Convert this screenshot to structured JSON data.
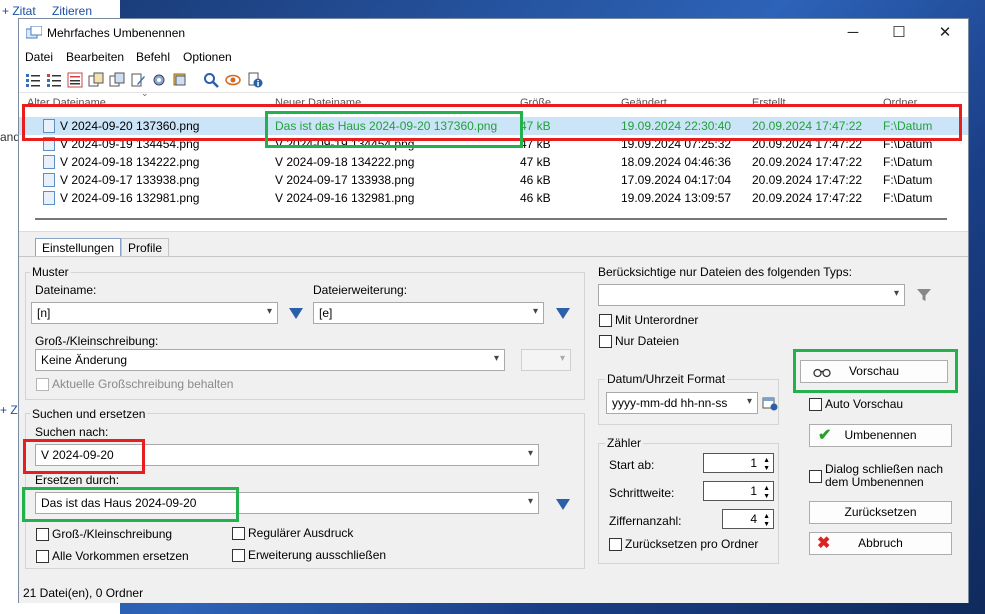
{
  "background": {
    "zitat": "+ Zitat",
    "zitieren": "Zitieren",
    "side_and": "and",
    "side_plus": "+ Z"
  },
  "window": {
    "title": "Mehrfaches Umbenennen",
    "minimize": "─",
    "maximize": "☐",
    "close": "✕"
  },
  "menu": {
    "items": [
      "Datei",
      "Bearbeiten",
      "Befehl",
      "Optionen"
    ]
  },
  "columns": [
    "Alter Dateiname",
    "Neuer Dateiname",
    "Größe",
    "Geändert",
    "Erstellt",
    "Ordner"
  ],
  "rows": [
    {
      "old": "V 2024-09-20 137360.png",
      "new": "Das ist das Haus 2024-09-20 137360.png",
      "size": "47 kB",
      "modified": "19.09.2024 22:30:40",
      "created": "20.09.2024 17:47:22",
      "folder": "F:\\Datum"
    },
    {
      "old": "V 2024-09-19 134454.png",
      "new": "V 2024-09-19 134454.png",
      "size": "47 kB",
      "modified": "19.09.2024 07:25:32",
      "created": "20.09.2024 17:47:22",
      "folder": "F:\\Datum"
    },
    {
      "old": "V 2024-09-18 134222.png",
      "new": "V 2024-09-18 134222.png",
      "size": "47 kB",
      "modified": "18.09.2024 04:46:36",
      "created": "20.09.2024 17:47:22",
      "folder": "F:\\Datum"
    },
    {
      "old": "V 2024-09-17 133938.png",
      "new": "V 2024-09-17 133938.png",
      "size": "46 kB",
      "modified": "17.09.2024 04:17:04",
      "created": "20.09.2024 17:47:22",
      "folder": "F:\\Datum"
    },
    {
      "old": "V 2024-09-16 132981.png",
      "new": "V 2024-09-16 132981.png",
      "size": "46 kB",
      "modified": "19.09.2024 13:09:57",
      "created": "20.09.2024 17:47:22",
      "folder": "F:\\Datum"
    }
  ],
  "tabs": [
    "Einstellungen",
    "Profile"
  ],
  "muster": {
    "group": "Muster",
    "filename_label": "Dateiname:",
    "filename_value": "[n]",
    "ext_label": "Dateierweiterung:",
    "ext_value": "[e]",
    "case_label": "Groß-/Kleinschreibung:",
    "case_value": "Keine Änderung",
    "keep_case": "Aktuelle Großschreibung behalten"
  },
  "search": {
    "group": "Suchen und ersetzen",
    "find_label": "Suchen nach:",
    "find_value": "V 2024-09-20",
    "replace_label": "Ersetzen durch:",
    "replace_value": "Das ist das Haus 2024-09-20",
    "case_sensitive": "Groß-/Kleinschreibung",
    "regex": "Regulärer Ausdruck",
    "replace_all": "Alle Vorkommen ersetzen",
    "exclude_ext": "Erweiterung ausschließen"
  },
  "filter": {
    "label": "Berücksichtige nur Dateien des folgenden Typs:",
    "value": "",
    "subfolders": "Mit Unterordner",
    "only_files": "Nur Dateien"
  },
  "datetime": {
    "group": "Datum/Uhrzeit Format",
    "value": "yyyy-mm-dd hh-nn-ss"
  },
  "counter": {
    "group": "Zähler",
    "start_label": "Start ab:",
    "start": "1",
    "step_label": "Schrittweite:",
    "step": "1",
    "digits_label": "Ziffernanzahl:",
    "digits": "4",
    "reset_per_folder": "Zurücksetzen pro Ordner"
  },
  "actions": {
    "preview": "Vorschau",
    "auto_preview": "Auto Vorschau",
    "rename": "Umbenennen",
    "close_after": "Dialog schließen nach dem Umbenennen",
    "reset": "Zurücksetzen",
    "cancel": "Abbruch"
  },
  "status": {
    "text": "21 Datei(en), 0 Ordner"
  }
}
